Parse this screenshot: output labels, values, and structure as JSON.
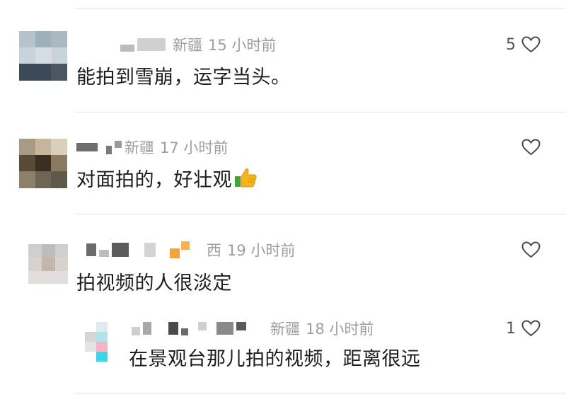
{
  "comments": [
    {
      "meta_location": "新疆",
      "meta_time": "15 小时前",
      "text": "能拍到雪崩，运字当头。",
      "like_count": "5"
    },
    {
      "meta_location": "新疆",
      "meta_time": "17 小时前",
      "text": "对面拍的，好壮观",
      "like_count": ""
    },
    {
      "meta_location": "西",
      "meta_time": "19 小时前",
      "text": "拍视频的人很淡定",
      "like_count": ""
    },
    {
      "meta_location": "新疆",
      "meta_time": "18 小时前",
      "text": "在景观台那儿拍的视频，距离很远",
      "like_count": "1"
    }
  ],
  "icons": {
    "like": "heart-outline-icon",
    "thumbs_up": "thumbs-up-emoji-icon"
  },
  "colors": {
    "text": "#1c1c1c",
    "meta": "#9e9e9e",
    "divider": "#e6e6e6"
  }
}
